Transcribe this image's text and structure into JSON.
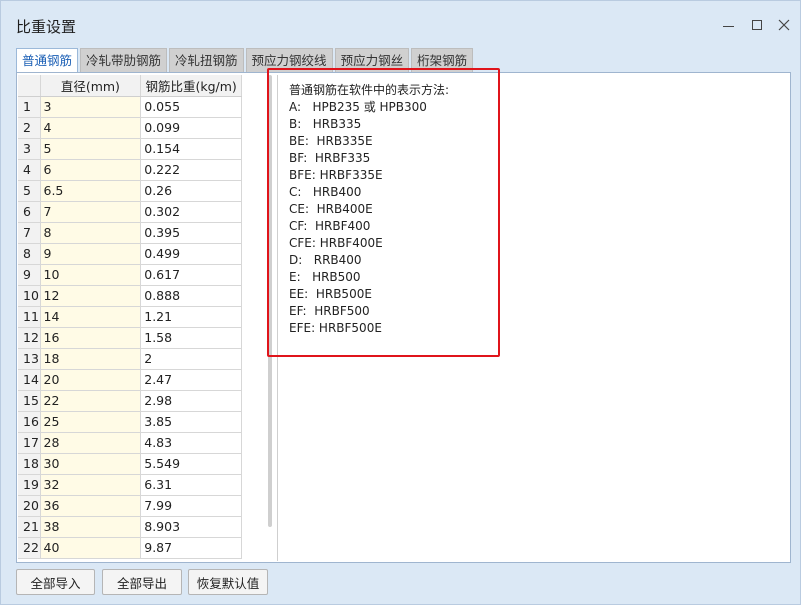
{
  "window": {
    "title": "比重设置"
  },
  "tabs": [
    {
      "label": "普通钢筋",
      "active": true
    },
    {
      "label": "冷轧带肋钢筋",
      "active": false
    },
    {
      "label": "冷轧扭钢筋",
      "active": false
    },
    {
      "label": "预应力钢绞线",
      "active": false
    },
    {
      "label": "预应力钢丝",
      "active": false
    },
    {
      "label": "桁架钢筋",
      "active": false
    }
  ],
  "table": {
    "headers": [
      "",
      "直径(mm)",
      "钢筋比重(kg/m)"
    ],
    "rows": [
      [
        "1",
        "3",
        "0.055"
      ],
      [
        "2",
        "4",
        "0.099"
      ],
      [
        "3",
        "5",
        "0.154"
      ],
      [
        "4",
        "6",
        "0.222"
      ],
      [
        "5",
        "6.5",
        "0.26"
      ],
      [
        "6",
        "7",
        "0.302"
      ],
      [
        "7",
        "8",
        "0.395"
      ],
      [
        "8",
        "9",
        "0.499"
      ],
      [
        "9",
        "10",
        "0.617"
      ],
      [
        "10",
        "12",
        "0.888"
      ],
      [
        "11",
        "14",
        "1.21"
      ],
      [
        "12",
        "16",
        "1.58"
      ],
      [
        "13",
        "18",
        "2"
      ],
      [
        "14",
        "20",
        "2.47"
      ],
      [
        "15",
        "22",
        "2.98"
      ],
      [
        "16",
        "25",
        "3.85"
      ],
      [
        "17",
        "28",
        "4.83"
      ],
      [
        "18",
        "30",
        "5.549"
      ],
      [
        "19",
        "32",
        "6.31"
      ],
      [
        "20",
        "36",
        "7.99"
      ],
      [
        "21",
        "38",
        "8.903"
      ],
      [
        "22",
        "40",
        "9.87"
      ]
    ]
  },
  "description": {
    "lines": [
      "普通钢筋在软件中的表示方法:",
      "A:   HPB235 或 HPB300",
      "B:   HRB335",
      "BE:  HRB335E",
      "BF:  HRBF335",
      "BFE: HRBF335E",
      "C:   HRB400",
      "CE:  HRB400E",
      "CF:  HRBF400",
      "CFE: HRBF400E",
      "D:   RRB400",
      "E:   HRB500",
      "EE:  HRB500E",
      "EF:  HRBF500",
      "EFE: HRBF500E"
    ]
  },
  "buttons": {
    "import_all": "全部导入",
    "export_all": "全部导出",
    "restore_default": "恢复默认值"
  },
  "colors": {
    "highlight": "#e0141b",
    "active_tab_text": "#1b5fb5",
    "diameter_cell_bg": "#fffbe6"
  }
}
